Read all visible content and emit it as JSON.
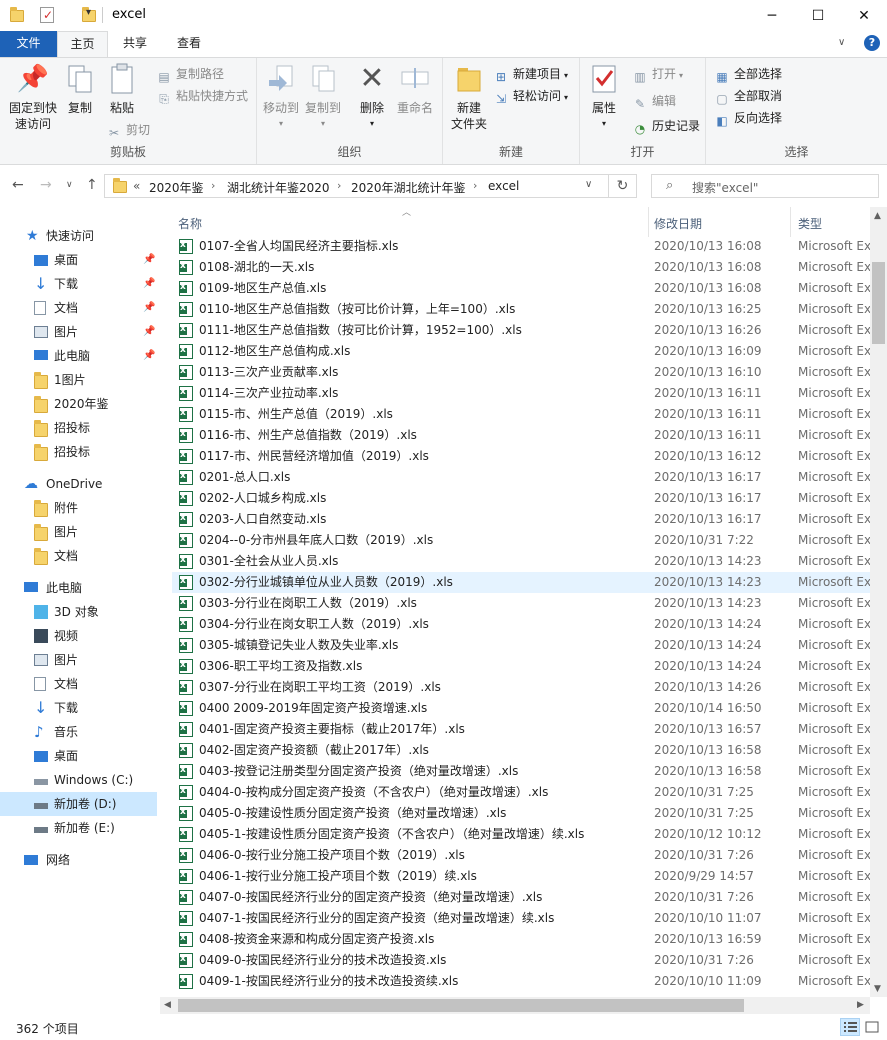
{
  "window": {
    "title": "excel",
    "minimize": "─",
    "maximize": "☐",
    "close": "✕"
  },
  "tabs": [
    {
      "label": "文件"
    },
    {
      "label": "主页"
    },
    {
      "label": "共享"
    },
    {
      "label": "查看"
    }
  ],
  "ribbon": {
    "clipboard": {
      "label": "剪贴板",
      "pin": "固定到快\n速访问",
      "pin_line1": "固定到快",
      "pin_line2": "速访问",
      "copy": "复制",
      "paste": "粘贴",
      "copy_path": "复制路径",
      "paste_shortcut": "粘贴快捷方式",
      "cut": "剪切"
    },
    "organize": {
      "label": "组织",
      "move_to": "移动到",
      "copy_to": "复制到",
      "delete": "删除",
      "rename": "重命名"
    },
    "new": {
      "label": "新建",
      "new_folder_line1": "新建",
      "new_folder_line2": "文件夹",
      "new_item": "新建项目",
      "easy_access": "轻松访问"
    },
    "open": {
      "label": "打开",
      "properties": "属性",
      "open": "打开",
      "edit": "编辑",
      "history": "历史记录"
    },
    "select": {
      "label": "选择",
      "select_all": "全部选择",
      "select_none": "全部取消",
      "invert": "反向选择"
    }
  },
  "address": {
    "overflow": "«",
    "crumbs": [
      "2020年鉴",
      "湖北统计年鉴2020",
      "2020年湖北统计年鉴",
      "excel"
    ],
    "search_placeholder": "搜索\"excel\""
  },
  "navpane": {
    "quick_access": "快速访问",
    "desktop": "桌面",
    "downloads": "下载",
    "documents": "文档",
    "pictures": "图片",
    "this_pc": "此电脑",
    "f1": "1图片",
    "f2": "2020年鉴",
    "f3": "招投标",
    "f4": "招投标",
    "onedrive": "OneDrive",
    "od1": "附件",
    "od2": "图片",
    "od3": "文档",
    "pc": "此电脑",
    "pc1": "3D 对象",
    "pc2": "视频",
    "pc3": "图片",
    "pc4": "文档",
    "pc5": "下载",
    "pc6": "音乐",
    "pc7": "桌面",
    "pc8": "Windows (C:)",
    "pc9": "新加卷 (D:)",
    "pc10": "新加卷 (E:)",
    "network": "网络"
  },
  "columns": {
    "name": "名称",
    "date": "修改日期",
    "type": "类型"
  },
  "files": [
    {
      "name": "0107-全省人均国民经济主要指标.xls",
      "date": "2020/10/13 16:08",
      "type": "Microsoft Ex"
    },
    {
      "name": "0108-湖北的一天.xls",
      "date": "2020/10/13 16:08",
      "type": "Microsoft Ex"
    },
    {
      "name": "0109-地区生产总值.xls",
      "date": "2020/10/13 16:08",
      "type": "Microsoft Ex"
    },
    {
      "name": "0110-地区生产总值指数（按可比价计算，上年=100）.xls",
      "date": "2020/10/13 16:25",
      "type": "Microsoft Ex"
    },
    {
      "name": "0111-地区生产总值指数（按可比价计算，1952=100）.xls",
      "date": "2020/10/13 16:26",
      "type": "Microsoft Ex"
    },
    {
      "name": "0112-地区生产总值构成.xls",
      "date": "2020/10/13 16:09",
      "type": "Microsoft Ex"
    },
    {
      "name": "0113-三次产业贡献率.xls",
      "date": "2020/10/13 16:10",
      "type": "Microsoft Ex"
    },
    {
      "name": "0114-三次产业拉动率.xls",
      "date": "2020/10/13 16:11",
      "type": "Microsoft Ex"
    },
    {
      "name": "0115-市、州生产总值（2019）.xls",
      "date": "2020/10/13 16:11",
      "type": "Microsoft Ex"
    },
    {
      "name": "0116-市、州生产总值指数（2019）.xls",
      "date": "2020/10/13 16:11",
      "type": "Microsoft Ex"
    },
    {
      "name": "0117-市、州民营经济增加值（2019）.xls",
      "date": "2020/10/13 16:12",
      "type": "Microsoft Ex"
    },
    {
      "name": "0201-总人口.xls",
      "date": "2020/10/13 16:17",
      "type": "Microsoft Ex"
    },
    {
      "name": "0202-人口城乡构成.xls",
      "date": "2020/10/13 16:17",
      "type": "Microsoft Ex"
    },
    {
      "name": "0203-人口自然变动.xls",
      "date": "2020/10/13 16:17",
      "type": "Microsoft Ex"
    },
    {
      "name": "0204--0-分市州县年底人口数（2019）.xls",
      "date": "2020/10/31 7:22",
      "type": "Microsoft Ex"
    },
    {
      "name": "0301-全社会从业人员.xls",
      "date": "2020/10/13 14:23",
      "type": "Microsoft Ex"
    },
    {
      "name": "0302-分行业城镇单位从业人员数（2019）.xls",
      "date": "2020/10/13 14:23",
      "type": "Microsoft Ex"
    },
    {
      "name": "0303-分行业在岗职工人数（2019）.xls",
      "date": "2020/10/13 14:23",
      "type": "Microsoft Ex"
    },
    {
      "name": "0304-分行业在岗女职工人数（2019）.xls",
      "date": "2020/10/13 14:24",
      "type": "Microsoft Ex"
    },
    {
      "name": "0305-城镇登记失业人数及失业率.xls",
      "date": "2020/10/13 14:24",
      "type": "Microsoft Ex"
    },
    {
      "name": "0306-职工平均工资及指数.xls",
      "date": "2020/10/13 14:24",
      "type": "Microsoft Ex"
    },
    {
      "name": "0307-分行业在岗职工平均工资（2019）.xls",
      "date": "2020/10/13 14:26",
      "type": "Microsoft Ex"
    },
    {
      "name": "0400 2009-2019年固定资产投资增速.xls",
      "date": "2020/10/14 16:50",
      "type": "Microsoft Ex"
    },
    {
      "name": "0401-固定资产投资主要指标（截止2017年）.xls",
      "date": "2020/10/13 16:57",
      "type": "Microsoft Ex"
    },
    {
      "name": "0402-固定资产投资额（截止2017年）.xls",
      "date": "2020/10/13 16:58",
      "type": "Microsoft Ex"
    },
    {
      "name": "0403-按登记注册类型分固定资产投资（绝对量改增速）.xls",
      "date": "2020/10/13 16:58",
      "type": "Microsoft Ex"
    },
    {
      "name": "0404-0-按构成分固定资产投资（不含农户）（绝对量改增速）.xls",
      "date": "2020/10/31 7:25",
      "type": "Microsoft Ex"
    },
    {
      "name": "0405-0-按建设性质分固定资产投资（绝对量改增速）.xls",
      "date": "2020/10/31 7:25",
      "type": "Microsoft Ex"
    },
    {
      "name": "0405-1-按建设性质分固定资产投资（不含农户）（绝对量改增速）续.xls",
      "date": "2020/10/12 10:12",
      "type": "Microsoft Ex"
    },
    {
      "name": "0406-0-按行业分施工投产项目个数（2019）.xls",
      "date": "2020/10/31 7:26",
      "type": "Microsoft Ex"
    },
    {
      "name": "0406-1-按行业分施工投产项目个数（2019）续.xls",
      "date": "2020/9/29 14:57",
      "type": "Microsoft Ex"
    },
    {
      "name": "0407-0-按国民经济行业分的固定资产投资（绝对量改增速）.xls",
      "date": "2020/10/31 7:26",
      "type": "Microsoft Ex"
    },
    {
      "name": "0407-1-按国民经济行业分的固定资产投资（绝对量改增速）续.xls",
      "date": "2020/10/10 11:07",
      "type": "Microsoft Ex"
    },
    {
      "name": "0408-按资金来源和构成分固定资产投资.xls",
      "date": "2020/10/13 16:59",
      "type": "Microsoft Ex"
    },
    {
      "name": "0409-0-按国民经济行业分的技术改造投资.xls",
      "date": "2020/10/31 7:26",
      "type": "Microsoft Ex"
    },
    {
      "name": "0409-1-按国民经济行业分的技术改造投资续.xls",
      "date": "2020/10/10 11:09",
      "type": "Microsoft Ex"
    }
  ],
  "status": {
    "count": "362 个项目"
  }
}
